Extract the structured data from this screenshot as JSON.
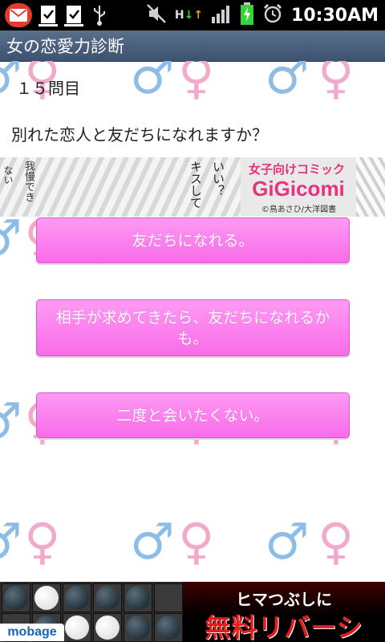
{
  "status_bar": {
    "time": "10:30AM",
    "network": "H"
  },
  "app": {
    "title": "女の恋愛力診断"
  },
  "question": {
    "number_label": "１５問目",
    "text": "別れた恋人と友だちになれますか？"
  },
  "banner": {
    "tagline": "女子向けコミック",
    "logo": "GiGicomi",
    "credit": "©鳥あさひ/大洋図書",
    "speech1": "キスして",
    "speech2": "いい？",
    "speech3": "我慢でき",
    "speech4": "ない"
  },
  "answers": [
    {
      "label": "友だちになれる。"
    },
    {
      "label": "相手が求めてきたら、友だちになれるかも。"
    },
    {
      "label": "二度と会いたくない。"
    }
  ],
  "ad": {
    "brand": "mobage",
    "line1": "ヒマつぶしに",
    "line2": "無料リバーシ"
  },
  "colors": {
    "button_top": "#ff9af4",
    "button_bottom": "#f86ce8",
    "male_symbol": "#8dbde6",
    "female_symbol": "#f2aacb",
    "title_bar": "#4a6080"
  }
}
